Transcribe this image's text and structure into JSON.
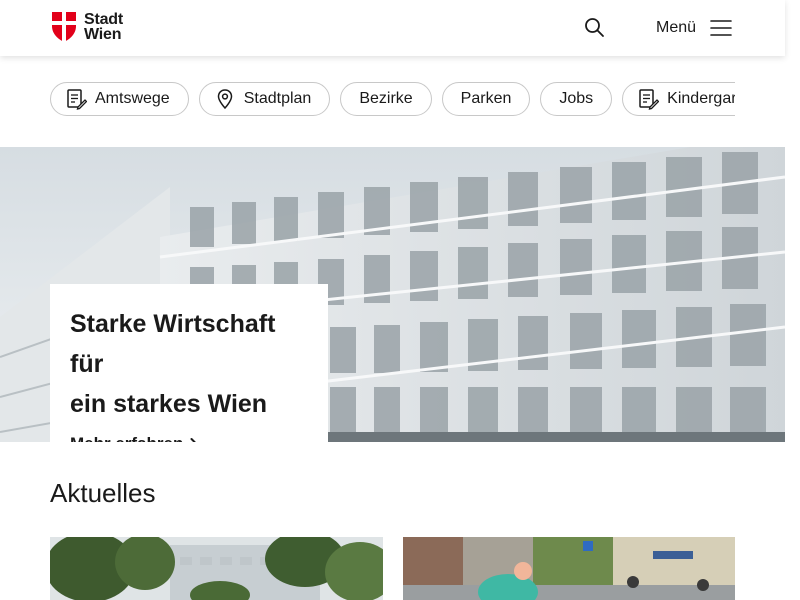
{
  "header": {
    "logo_line1": "Stadt",
    "logo_line2": "Wien",
    "menu_label": "Menü",
    "colors": {
      "brand_red": "#e2001a"
    }
  },
  "chips": [
    {
      "label": "Amtswege",
      "icon": "document-edit-icon"
    },
    {
      "label": "Stadtplan",
      "icon": "map-pin-icon"
    },
    {
      "label": "Bezirke"
    },
    {
      "label": "Parken"
    },
    {
      "label": "Jobs"
    },
    {
      "label": "Kindergarten",
      "icon": "document-edit-icon"
    }
  ],
  "hero": {
    "title_line1": "Starke Wirtschaft für",
    "title_line2": "ein starkes Wien",
    "link_label": "Mehr erfahren"
  },
  "news": {
    "section_title": "Aktuelles"
  }
}
